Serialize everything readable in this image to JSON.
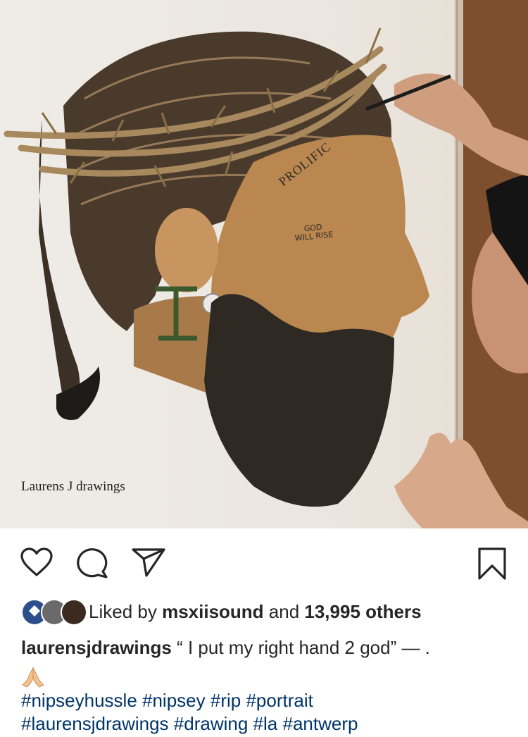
{
  "post": {
    "image_alt": "Colored pencil portrait drawing in progress",
    "watermark": "Laurens J drawings",
    "tattoo_prolific": "PROLIFIC",
    "tattoo_god_line1": "GOD",
    "tattoo_god_line2": "WILL RISE"
  },
  "actions": {
    "like_icon": "heart-icon",
    "comment_icon": "comment-icon",
    "share_icon": "send-icon",
    "save_icon": "bookmark-icon"
  },
  "likes": {
    "prefix": "Liked by ",
    "user": "msxiisound",
    "middle": " and ",
    "count": "13,995 others"
  },
  "caption": {
    "username": "laurensjdrawings",
    "text": " “ I put my right hand 2 god” — .",
    "emoji": "folded-hands"
  },
  "hashtags": [
    "#nipseyhussle",
    "#nipsey",
    "#rip",
    "#portrait",
    "#laurensjdrawings",
    "#drawing",
    "#la",
    "#antwerp"
  ],
  "colors": {
    "text": "#262626",
    "hashtag": "#003569",
    "background": "#ffffff"
  }
}
